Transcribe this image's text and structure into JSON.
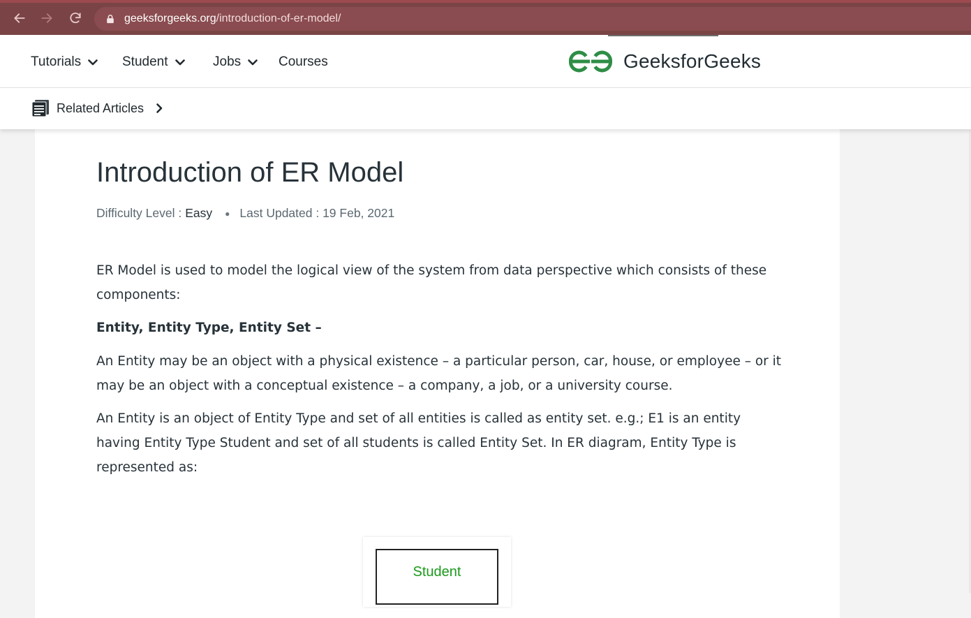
{
  "browser": {
    "url_host": "geeksforgeeks.org",
    "url_path": "/introduction-of-er-model/"
  },
  "header": {
    "menu": [
      {
        "label": "Tutorials",
        "has_dropdown": true
      },
      {
        "label": "Student",
        "has_dropdown": true
      },
      {
        "label": "Jobs",
        "has_dropdown": true
      },
      {
        "label": "Courses",
        "has_dropdown": false
      }
    ],
    "logo_text": "GeeksforGeeks",
    "brand_color": "#2f8d46"
  },
  "related": {
    "label": "Related Articles"
  },
  "article": {
    "title": "Introduction of ER Model",
    "difficulty_prefix": "Difficulty Level :",
    "difficulty": "Easy",
    "updated": "Last Updated : 19 Feb, 2021",
    "paragraphs": {
      "p1": "ER Model is used to model the logical view of the system from data perspective which consists of these components:",
      "subhead": "Entity, Entity Type, Entity Set –",
      "p2": "An Entity may be an object with a physical existence – a particular person, car, house, or employee – or it may be an object with a conceptual existence – a company, a job, or a university course.",
      "p3": "An Entity is an object of Entity Type and set of all entities is called as entity set. e.g.; E1 is an entity having Entity Type Student and set of all students is called Entity Set. In ER diagram, Entity Type is represented as:"
    },
    "figure": {
      "entity_label": "Student"
    }
  }
}
